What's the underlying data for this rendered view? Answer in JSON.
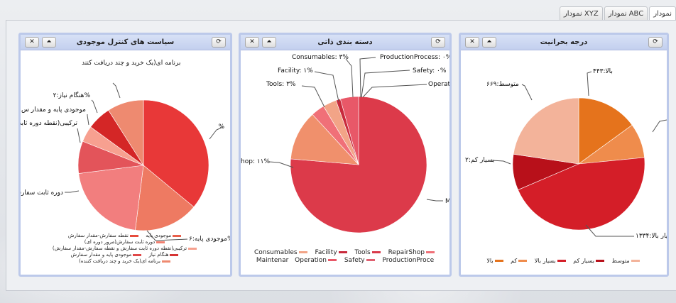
{
  "tabs": [
    {
      "label": "نمودار",
      "active": true
    },
    {
      "label": "نمودار ABC",
      "active": false
    },
    {
      "label": "نمودار XYZ",
      "active": false
    }
  ],
  "panels": {
    "control": {
      "title": "سیاست های کنترل موجودی",
      "refresh_icon": "refresh-icon",
      "settings_icon": "circle-icon",
      "close_icon": "close-icon",
      "labels": [
        "برنامه ای(یک خرید و چند دریافت کنند",
        "هنگام نیاز:۲%",
        "موجودی پایه و مقدار س",
        "ترکیبی(نقطه دوره ثابت س",
        "دوره ثابت سفارش",
        "موجودی پایه:۶%",
        "%"
      ],
      "legend": [
        {
          "label": "نقطه سفارش-مقدار سفارش",
          "color": "#e74c3c"
        },
        {
          "label": "موجودی پایه",
          "color": "#e85f4a"
        },
        {
          "label": "دوره ثابت سفارش(مرور دوره ای)",
          "color": "#f08070"
        },
        {
          "label": "ترکیبی(نقطه دوره ثابت سفارش و نقطه سفارش-مقدار سفارش)",
          "color": "#f6a08e"
        },
        {
          "label": "موجودی پایه و مقدار سفارش",
          "color": "#e04848"
        },
        {
          "label": "هنگام نیاز",
          "color": "#d63434"
        },
        {
          "label": "برنامه ای(یک خرید و چند دریافت کننده)",
          "color": "#ee8a70"
        }
      ]
    },
    "category": {
      "title": "دسته بندی ذاتی",
      "refresh_icon": "refresh-icon",
      "settings_icon": "circle-icon",
      "close_icon": "close-icon",
      "labels": [
        "Consumables: ۳%",
        "ProductionProcess: ۰%",
        "Facility: ۱%",
        "Safety: ۰%",
        "Tools: ۳%",
        "Operati",
        "hop: ۱۱%",
        "M"
      ],
      "legend": [
        {
          "label": "Consumables",
          "color": "#f2a487"
        },
        {
          "label": "Facility",
          "color": "#c82a3c"
        },
        {
          "label": "Tools",
          "color": "#d93a4a"
        },
        {
          "label": "RepairShop",
          "color": "#f07078"
        },
        {
          "label": "Maintenar",
          "color": "#f0906c"
        },
        {
          "label": "Operation",
          "color": "#e85868"
        },
        {
          "label": "Safety",
          "color": "#e06070"
        },
        {
          "label": "ProductionProce",
          "color": "#ef8894"
        }
      ]
    },
    "criticality": {
      "title": "درجه بحرانیت",
      "refresh_icon": "refresh-icon",
      "settings_icon": "circle-icon",
      "close_icon": "close-icon",
      "labels": [
        "بالا:۴۴۳",
        "متوسط:۶۶۹",
        "بسیار کم:۲",
        "بسیار بالا:۱۳۳۴"
      ],
      "legend": [
        {
          "label": "بالا",
          "color": "#e5731c"
        },
        {
          "label": "کم",
          "color": "#ef8c4c"
        },
        {
          "label": "بسیار بالا",
          "color": "#d41e28"
        },
        {
          "label": "بسیار کم",
          "color": "#b8101a"
        },
        {
          "label": "متوسط",
          "color": "#f3b39a"
        }
      ]
    }
  },
  "chart_data": [
    {
      "type": "pie",
      "title": "سیاست های کنترل موجودی",
      "categories": [
        "نقطه سفارش-مقدار سفارش",
        "موجودی پایه",
        "دوره ثابت سفارش",
        "ترکیبی",
        "موجودی پایه و مقدار سفارش",
        "هنگام نیاز",
        "برنامه ای"
      ],
      "values": [
        36,
        16,
        21,
        8,
        4,
        6,
        9
      ],
      "colors": [
        "#e83838",
        "#ee7a62",
        "#f27e7e",
        "#e3545a",
        "#f7a090",
        "#d42626",
        "#ee8a70"
      ]
    },
    {
      "type": "pie",
      "title": "دسته بندی ذاتی",
      "categories": [
        "Maintenance",
        "RepairShop",
        "Tools",
        "Consumables",
        "Facility",
        "ProductionProcess",
        "Safety",
        "Operation"
      ],
      "values": [
        71,
        11,
        3,
        3,
        1,
        0,
        0,
        4
      ],
      "colors": [
        "#dc3a4a",
        "#f0906c",
        "#f07078",
        "#f2a487",
        "#c82a3c",
        "#ef8894",
        "#e06070",
        "#e85868"
      ]
    },
    {
      "type": "pie",
      "title": "درجه بحرانیت",
      "categories": [
        "بالا",
        "کم",
        "بسیار بالا",
        "بسیار کم",
        "متوسط"
      ],
      "values": [
        443,
        250,
        1334,
        260,
        669
      ],
      "colors": [
        "#e5731c",
        "#ef8c4c",
        "#d41e28",
        "#b8101a",
        "#f3b39a"
      ]
    }
  ]
}
